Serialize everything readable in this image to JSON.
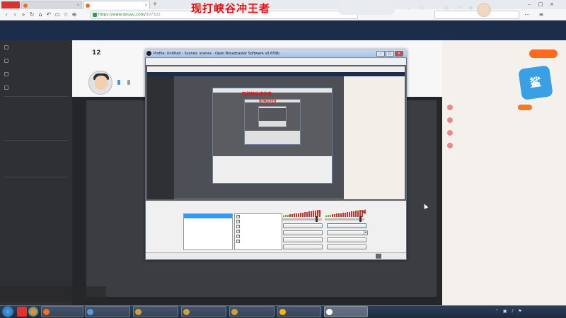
{
  "browser": {
    "badge": "",
    "tabs": [
      {
        "label": "",
        "active": false
      },
      {
        "label": "",
        "active": true
      }
    ],
    "new_tab": "+",
    "url_host": "https://www.douyu.com/",
    "url_path": "307322",
    "search_placeholder": ""
  },
  "overlay_title": "现打峡谷冲王者",
  "site": {
    "logo": "",
    "nav": [
      "",
      "",
      "",
      "",
      "",
      "",
      ""
    ],
    "active_nav_index": 1,
    "search_placeholder": "",
    "icons": [
      {
        "icon": "download-icon",
        "label": ""
      },
      {
        "icon": "history-icon",
        "label": ""
      },
      {
        "icon": "follow-icon",
        "label": ""
      },
      {
        "icon": "record-icon",
        "label": ""
      },
      {
        "icon": "message-icon",
        "label": ""
      },
      {
        "icon": "broadcast-icon",
        "label": ""
      }
    ]
  },
  "sidebar": {
    "items": [
      "",
      "",
      "",
      ""
    ],
    "sections": [
      {
        "title": "",
        "grid": [
          "",
          "",
          "",
          "",
          "",
          "",
          "",
          "",
          "",
          "",
          "",
          "",
          "",
          "",
          ""
        ]
      },
      {
        "title": "",
        "grid": [
          "",
          "",
          "",
          "",
          "",
          "",
          "",
          "",
          ""
        ]
      },
      {
        "title": "",
        "grid": [
          "",
          "",
          "",
          "",
          "",
          "",
          "",
          "",
          "",
          "",
          "",
          "",
          "",
          "",
          ""
        ]
      }
    ]
  },
  "room": {
    "count": "12",
    "count_sub": "",
    "anchor_name": "",
    "badges": [
      "",
      ""
    ]
  },
  "right_panel": {
    "pc_client": "",
    "rank_title": "",
    "rows": [
      {
        "name": ""
      },
      {
        "name": ""
      },
      {
        "name": ""
      },
      {
        "name": ""
      }
    ],
    "announcement": ""
  },
  "obs": {
    "title": "Profile: Untitled - Scenes: scenes - Open Broadcaster Software v0.659b",
    "menus": [
      "",
      "",
      "",
      "",
      ""
    ],
    "scenes_label": "",
    "scene_selected": "",
    "sources_label": "",
    "sources": [
      "",
      "",
      "",
      "",
      "",
      ""
    ],
    "buttons": {
      "settings": "",
      "stop_stream": "",
      "edit_scene": "",
      "start_record": "",
      "fullscreen_preview": "",
      "preview_stream": "",
      "plugins": "",
      "exit": ""
    },
    "status_left": "",
    "status_time": "",
    "status_dropped": "",
    "status_fps": "",
    "status_bitrate": "",
    "nested_title": "现打峡谷冲王者",
    "nested_watermark": ""
  },
  "streamer_watermark": "",
  "taskbar": {
    "tasks": [
      {
        "label": "",
        "color": "#f37021"
      },
      {
        "label": "",
        "color": "#5b9bd5"
      },
      {
        "label": "",
        "color": "#c8a23a"
      },
      {
        "label": "",
        "color": "#c8a23a"
      },
      {
        "label": "",
        "color": "#c8a23a"
      },
      {
        "label": "",
        "color": "#f0b800"
      },
      {
        "label": "",
        "color": "#ffffff"
      }
    ],
    "time": "",
    "date": ""
  },
  "colors": {
    "accent": "#ff8a2a",
    "title_red": "#e41010",
    "site_nav_bg": "#1b2d4a"
  }
}
